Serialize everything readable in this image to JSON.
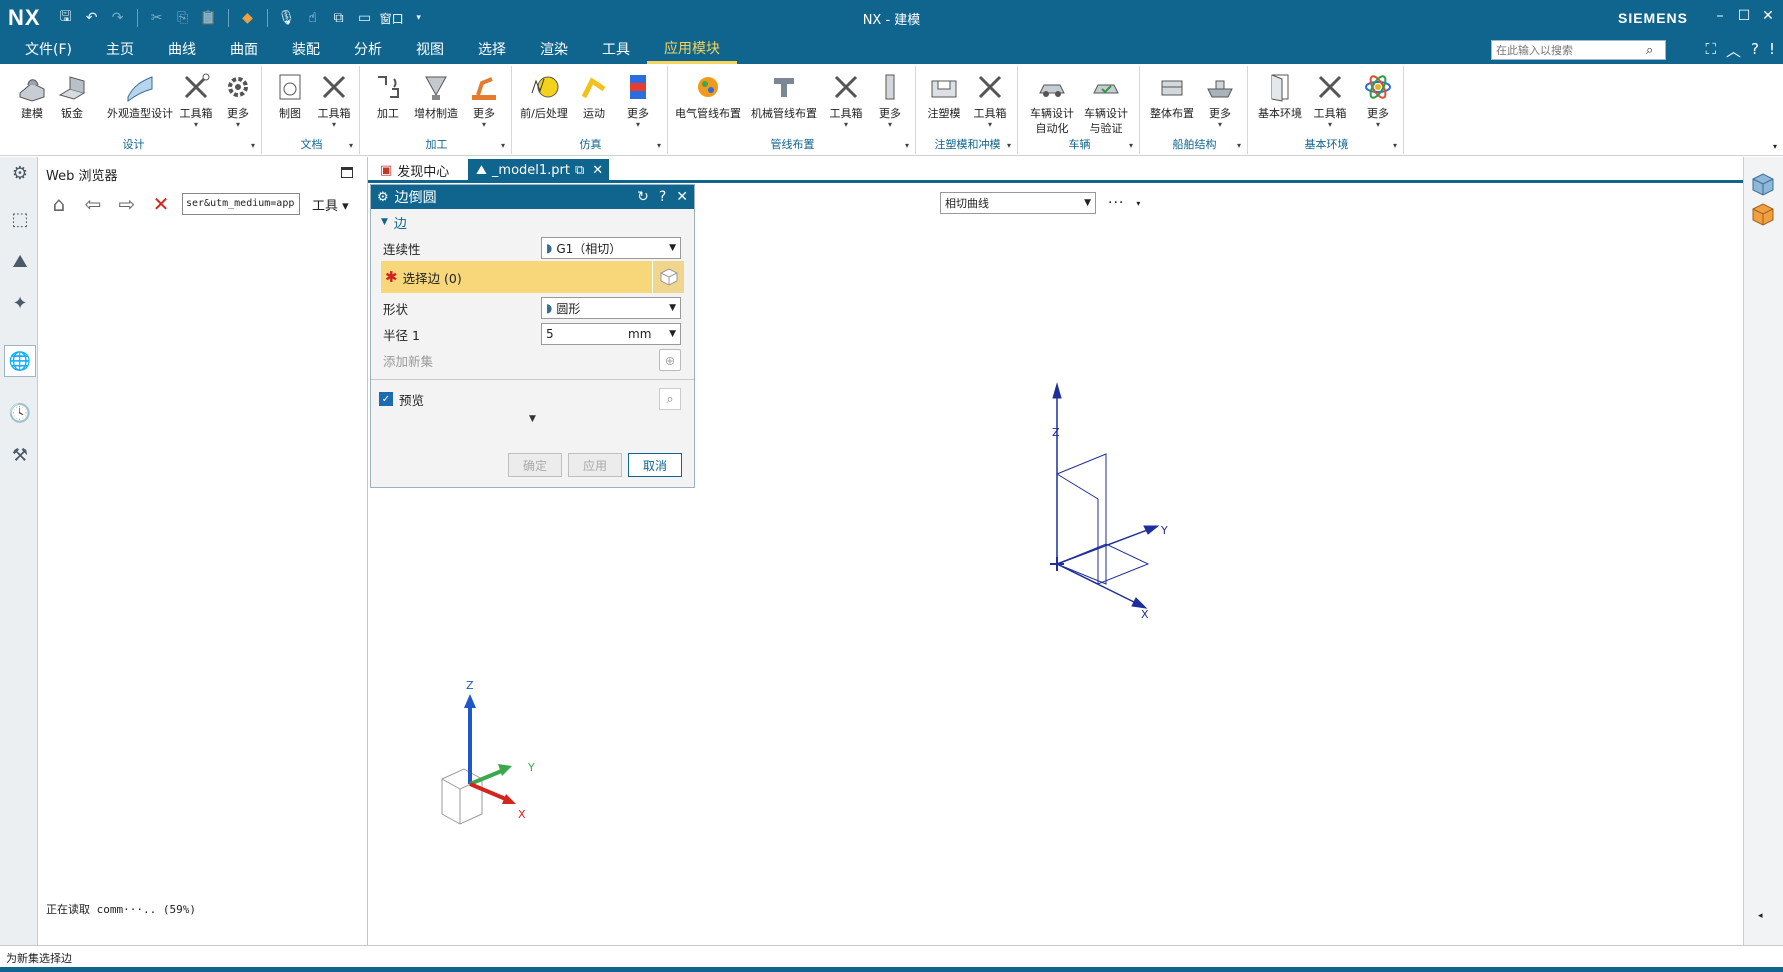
{
  "app": {
    "logo": "NX",
    "window_title": "NX - 建模",
    "brand": "SIEMENS",
    "quick_access": {
      "window_label": "窗口"
    }
  },
  "menu": {
    "items": [
      "文件(F)",
      "主页",
      "曲线",
      "曲面",
      "装配",
      "分析",
      "视图",
      "选择",
      "渲染",
      "工具",
      "应用模块"
    ],
    "active_index": 10,
    "search_placeholder": "在此输入以搜索"
  },
  "ribbon": {
    "groups": [
      {
        "label": "设计",
        "buttons": [
          "建模",
          "钣金",
          "外观造型设计",
          "工具箱",
          "更多"
        ]
      },
      {
        "label": "文档",
        "buttons": [
          "制图",
          "工具箱"
        ]
      },
      {
        "label": "加工",
        "buttons": [
          "加工",
          "增材制造",
          "更多"
        ]
      },
      {
        "label": "仿真",
        "buttons": [
          "前/后处理",
          "运动",
          "更多"
        ]
      },
      {
        "label": "管线布置",
        "buttons": [
          "电气管线布置",
          "机械管线布置",
          "工具箱",
          "更多"
        ]
      },
      {
        "label": "注塑模和冲模",
        "buttons": [
          "注塑模",
          "工具箱"
        ]
      },
      {
        "label": "车辆",
        "buttons": [
          "车辆设计自动化",
          "车辆设计与验证"
        ]
      },
      {
        "label": "船舶结构",
        "buttons": [
          "整体布置",
          "更多"
        ]
      },
      {
        "label": "基本环境",
        "buttons": [
          "基本环境",
          "工具箱",
          "更多"
        ]
      }
    ]
  },
  "web_panel": {
    "title": "Web 浏览器",
    "url": "ser&utm_medium=app",
    "tools_label": "工具",
    "status": "正在读取 comm···.. (59%)"
  },
  "tabs": [
    {
      "label": "发现中心"
    },
    {
      "label": "_model1.prt"
    }
  ],
  "selection_bar": {
    "curve_rule": "相切曲线",
    "more": "···"
  },
  "dialog": {
    "title": "边倒圆",
    "section": "边",
    "continuity_label": "连续性",
    "continuity_value": "G1（相切）",
    "select_edge_label": "选择边 (0)",
    "shape_label": "形状",
    "shape_value": "圆形",
    "radius_label": "半径 1",
    "radius_value": "5",
    "radius_unit": "mm",
    "add_set_label": "添加新集",
    "preview_label": "预览",
    "preview_checked": true,
    "ok": "确定",
    "apply": "应用",
    "cancel": "取消"
  },
  "axes": {
    "z": "Z",
    "y": "Y",
    "x": "X"
  },
  "status_bar": {
    "text": "为新集选择边"
  },
  "colors": {
    "accent": "#10658f",
    "highlight": "#f7d77a",
    "active_menu": "#f4d35e"
  }
}
